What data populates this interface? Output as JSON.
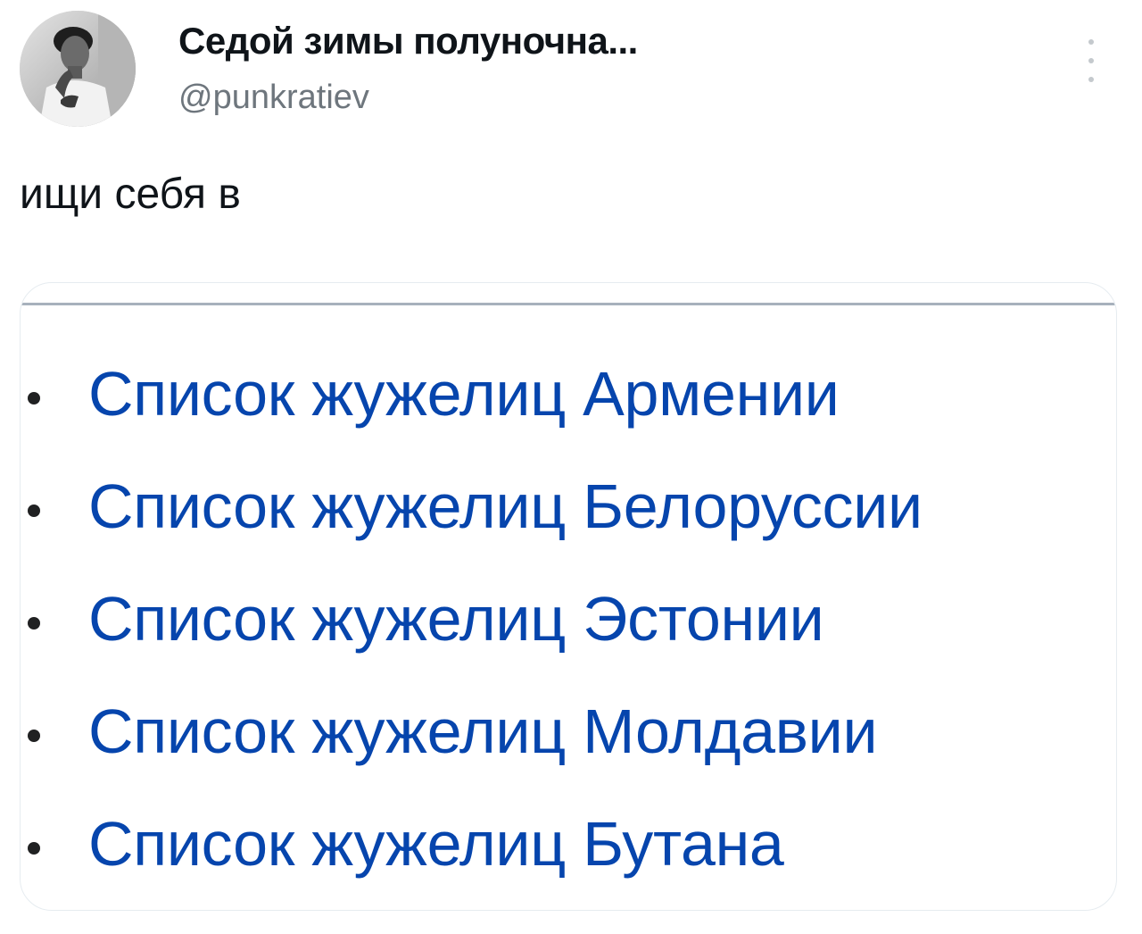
{
  "header": {
    "display_name": "Седой зимы полуночна...",
    "handle": "@punkratiev",
    "more_icon": "more-vertical-icon",
    "avatar_icon": "avatar-photo"
  },
  "tweet": {
    "text": "ищи себя в"
  },
  "media": {
    "links": [
      {
        "label": "Список жужелиц Армении"
      },
      {
        "label": "Список жужелиц Белоруссии"
      },
      {
        "label": "Список жужелиц Эстонии"
      },
      {
        "label": "Список жужелиц Молдавии"
      },
      {
        "label": "Список жужелиц Бутана"
      }
    ],
    "link_color": "#0645ad",
    "bullet_color": "#202122"
  },
  "colors": {
    "handle": "#6e767d",
    "text": "#0f1419",
    "card_border": "#e6ecf0"
  }
}
